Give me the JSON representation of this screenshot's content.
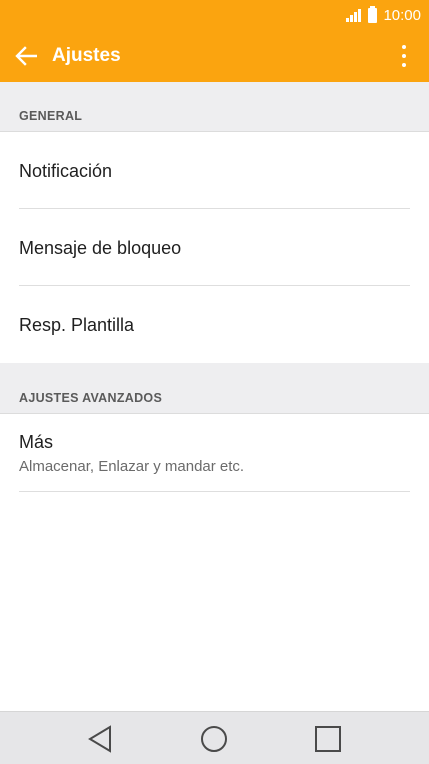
{
  "status_bar": {
    "time": "10:00",
    "icons": [
      "signal-icon",
      "battery-icon"
    ]
  },
  "toolbar": {
    "title": "Ajustes",
    "back_icon": "back-arrow-icon",
    "menu_icon": "overflow-menu-icon",
    "background_color": "#fba40f"
  },
  "sections": [
    {
      "header": "GENERAL",
      "items": [
        {
          "title": "Notificación"
        },
        {
          "title": "Mensaje de bloqueo"
        },
        {
          "title": "Resp. Plantilla"
        }
      ]
    },
    {
      "header": "AJUSTES AVANZADOS",
      "items": [
        {
          "title": "Más",
          "subtitle": "Almacenar, Enlazar y mandar etc."
        }
      ]
    }
  ],
  "navigation_bar": {
    "buttons": [
      "back-triangle-icon",
      "home-circle-icon",
      "recents-square-icon"
    ]
  }
}
